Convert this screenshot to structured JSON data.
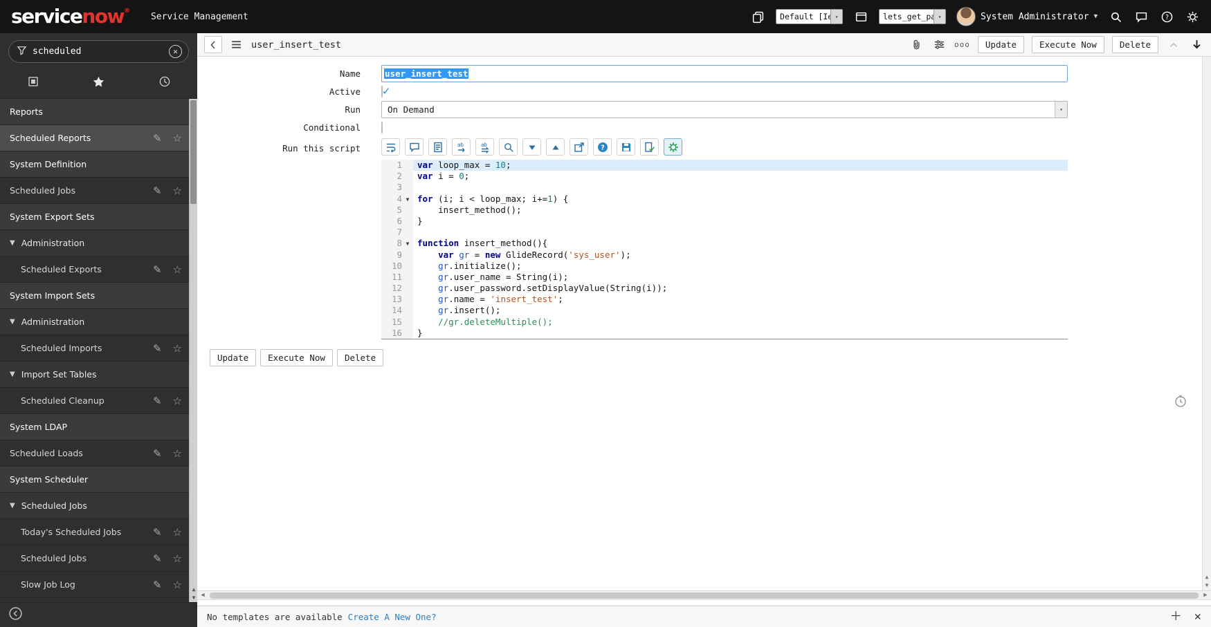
{
  "colors": {
    "brand_red": "#e3342b",
    "selection_blue": "#3297fd",
    "checkbox_check": "#2e8ef7",
    "link_blue": "#2f7fbe",
    "editor_icon_blue": "#2e6f9e"
  },
  "header": {
    "logo_service": "service",
    "logo_now": "now",
    "logo_reg": "®",
    "app_label": "Service Management",
    "update_set_value": "Default [Ie",
    "app_picker_value": "lets_get_pa",
    "user_name": "System Administrator"
  },
  "sidebar": {
    "filter_value": "scheduled",
    "items": [
      {
        "type": "section",
        "label": "Reports"
      },
      {
        "type": "module",
        "label": "Scheduled Reports",
        "selected": true
      },
      {
        "type": "section",
        "label": "System Definition"
      },
      {
        "type": "module",
        "label": "Scheduled Jobs"
      },
      {
        "type": "section",
        "label": "System Export Sets"
      },
      {
        "type": "group",
        "label": "Administration"
      },
      {
        "type": "module",
        "label": "Scheduled Exports",
        "indent": true
      },
      {
        "type": "section",
        "label": "System Import Sets"
      },
      {
        "type": "group",
        "label": "Administration"
      },
      {
        "type": "module",
        "label": "Scheduled Imports",
        "indent": true
      },
      {
        "type": "group",
        "label": "Import Set Tables"
      },
      {
        "type": "module",
        "label": "Scheduled Cleanup",
        "indent": true
      },
      {
        "type": "section",
        "label": "System LDAP"
      },
      {
        "type": "module",
        "label": "Scheduled Loads"
      },
      {
        "type": "section",
        "label": "System Scheduler"
      },
      {
        "type": "group",
        "label": "Scheduled Jobs"
      },
      {
        "type": "module",
        "label": "Today's Scheduled Jobs",
        "indent": true
      },
      {
        "type": "module",
        "label": "Scheduled Jobs",
        "indent": true
      },
      {
        "type": "module",
        "label": "Slow Job Log",
        "indent": true
      }
    ]
  },
  "main": {
    "record_title": "user_insert_test",
    "more_label": "ooo",
    "buttons": {
      "update": "Update",
      "execute": "Execute Now",
      "delete": "Delete"
    },
    "form": {
      "name_label": "Name",
      "name_value": "user_insert_test",
      "active_label": "Active",
      "active_checked": true,
      "run_label": "Run",
      "run_value": "On Demand",
      "conditional_label": "Conditional",
      "conditional_checked": false,
      "script_label": "Run this script"
    },
    "editor": {
      "toolbar": [
        "toggle-wrap",
        "toggle-comment",
        "format-code",
        "replace",
        "replace-all",
        "find",
        "find-next",
        "find-previous",
        "open-in-window",
        "help",
        "save",
        "syntax-check",
        "script-debugger"
      ],
      "lines": [
        {
          "n": 1,
          "active": true,
          "tokens": [
            [
              "kw",
              "var"
            ],
            [
              "pl",
              " loop_max = "
            ],
            [
              "num",
              "10"
            ],
            [
              "pl",
              ";"
            ]
          ]
        },
        {
          "n": 2,
          "tokens": [
            [
              "kw",
              "var"
            ],
            [
              "pl",
              " i = "
            ],
            [
              "num",
              "0"
            ],
            [
              "pl",
              ";"
            ]
          ]
        },
        {
          "n": 3,
          "tokens": []
        },
        {
          "n": 4,
          "fold": true,
          "tokens": [
            [
              "kw",
              "for"
            ],
            [
              "pl",
              " (i; i < loop_max; i+="
            ],
            [
              "num",
              "1"
            ],
            [
              "pl",
              ") {"
            ]
          ]
        },
        {
          "n": 5,
          "tokens": [
            [
              "pl",
              "    insert_method();"
            ]
          ]
        },
        {
          "n": 6,
          "tokens": [
            [
              "pl",
              "}"
            ]
          ]
        },
        {
          "n": 7,
          "tokens": []
        },
        {
          "n": 8,
          "fold": true,
          "tokens": [
            [
              "kw",
              "function"
            ],
            [
              "pl",
              " insert_method(){"
            ]
          ]
        },
        {
          "n": 9,
          "tokens": [
            [
              "pl",
              "    "
            ],
            [
              "kw",
              "var"
            ],
            [
              "pl",
              " "
            ],
            [
              "def",
              "gr"
            ],
            [
              "pl",
              " = "
            ],
            [
              "kw",
              "new"
            ],
            [
              "pl",
              " GlideRecord("
            ],
            [
              "str",
              "'sys_user'"
            ],
            [
              "pl",
              ");"
            ]
          ]
        },
        {
          "n": 10,
          "tokens": [
            [
              "pl",
              "    "
            ],
            [
              "def",
              "gr"
            ],
            [
              "pl",
              ".initialize();"
            ]
          ]
        },
        {
          "n": 11,
          "tokens": [
            [
              "pl",
              "    "
            ],
            [
              "def",
              "gr"
            ],
            [
              "pl",
              ".user_name = String(i);"
            ]
          ]
        },
        {
          "n": 12,
          "tokens": [
            [
              "pl",
              "    "
            ],
            [
              "def",
              "gr"
            ],
            [
              "pl",
              ".user_password.setDisplayValue(String(i));"
            ]
          ]
        },
        {
          "n": 13,
          "tokens": [
            [
              "pl",
              "    "
            ],
            [
              "def",
              "gr"
            ],
            [
              "pl",
              ".name = "
            ],
            [
              "str",
              "'insert_test'"
            ],
            [
              "pl",
              ";"
            ]
          ]
        },
        {
          "n": 14,
          "tokens": [
            [
              "pl",
              "    "
            ],
            [
              "def",
              "gr"
            ],
            [
              "pl",
              ".insert();"
            ]
          ]
        },
        {
          "n": 15,
          "tokens": [
            [
              "pl",
              "    "
            ],
            [
              "com",
              "//gr.deleteMultiple();"
            ]
          ]
        },
        {
          "n": 16,
          "tokens": [
            [
              "pl",
              "}"
            ]
          ]
        }
      ]
    }
  },
  "footer": {
    "message": "No templates are available",
    "link_label": "Create A New One?"
  }
}
